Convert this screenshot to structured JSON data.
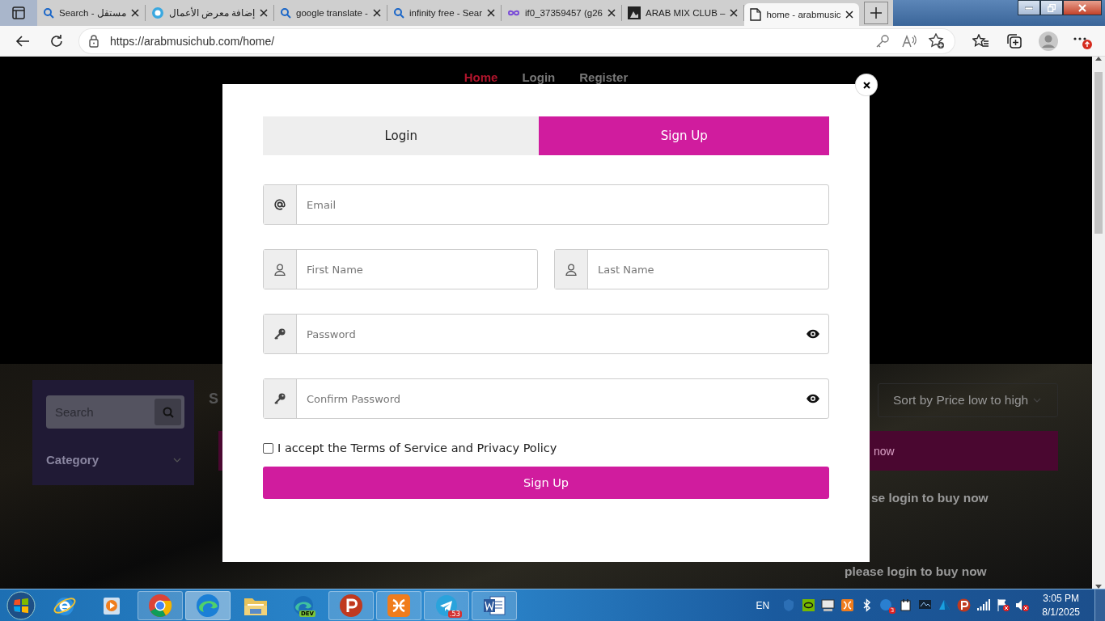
{
  "browser": {
    "tabs": [
      {
        "kind": "search",
        "title": "Search - مستقل",
        "selected": false
      },
      {
        "kind": "circle",
        "title": "إضافة معرض الأعمال",
        "selected": false
      },
      {
        "kind": "search",
        "title": "google translate -",
        "selected": false
      },
      {
        "kind": "search",
        "title": "infinity free - Sear",
        "selected": false
      },
      {
        "kind": "infinity",
        "title": "if0_37359457 (g26",
        "selected": false
      },
      {
        "kind": "photo",
        "title": "ARAB MIX CLUB –",
        "selected": false
      },
      {
        "kind": "page",
        "title": "home - arabmusic",
        "selected": true
      }
    ],
    "url": "https://arabmusichub.com/home/"
  },
  "page": {
    "nav": [
      {
        "label": "Home",
        "selected": true
      },
      {
        "label": "Login",
        "selected": false
      },
      {
        "label": "Register",
        "selected": false
      }
    ],
    "sidebar": {
      "search_placeholder": "Search",
      "category": "Category"
    },
    "heading_fragment": "S",
    "sort": "Sort by Price low to high",
    "banner_text": "now",
    "notices": [
      "se login to buy now",
      "please login to buy now"
    ]
  },
  "modal": {
    "tabs": [
      {
        "label": "Login",
        "selected": false
      },
      {
        "label": "Sign Up",
        "selected": true
      }
    ],
    "rows": [
      [
        {
          "kind": "email",
          "placeholder": "Email"
        }
      ],
      [
        {
          "kind": "person",
          "placeholder": "First Name"
        },
        {
          "kind": "person",
          "placeholder": "Last Name"
        }
      ],
      [
        {
          "kind": "secret",
          "placeholder": "Password"
        }
      ],
      [
        {
          "kind": "secret",
          "placeholder": "Confirm Password"
        }
      ]
    ],
    "terms": {
      "label": "I accept the Terms of Service and Privacy Policy",
      "checked": false
    },
    "submit": "Sign Up"
  },
  "taskbar": {
    "apps": [
      {
        "kind": "ie",
        "running": false,
        "selected": false
      },
      {
        "kind": "media",
        "running": false,
        "selected": false
      },
      {
        "kind": "chrome",
        "running": true,
        "selected": false
      },
      {
        "kind": "edge",
        "running": true,
        "selected": true
      },
      {
        "kind": "folder",
        "running": false,
        "selected": false
      },
      {
        "kind": "edgedev",
        "running": false,
        "selected": false,
        "label": "DEV"
      },
      {
        "kind": "psiphon",
        "running": true,
        "selected": false
      },
      {
        "kind": "xampp",
        "running": true,
        "selected": false
      },
      {
        "kind": "telegram",
        "running": true,
        "selected": false,
        "badge": ".53"
      },
      {
        "kind": "word",
        "running": true,
        "selected": false
      }
    ],
    "language": "EN",
    "tray": [
      {
        "kind": "shield"
      },
      {
        "kind": "nvidia"
      },
      {
        "kind": "monitor"
      },
      {
        "kind": "xampp"
      },
      {
        "kind": "bluetooth"
      },
      {
        "kind": "alert",
        "badge": "3"
      },
      {
        "kind": "plug"
      },
      {
        "kind": "screen"
      },
      {
        "kind": "drive"
      },
      {
        "kind": "psiphon"
      },
      {
        "kind": "signal"
      },
      {
        "kind": "flag"
      },
      {
        "kind": "mute"
      }
    ],
    "time": "3:05 PM",
    "date": "8/1/2025"
  }
}
